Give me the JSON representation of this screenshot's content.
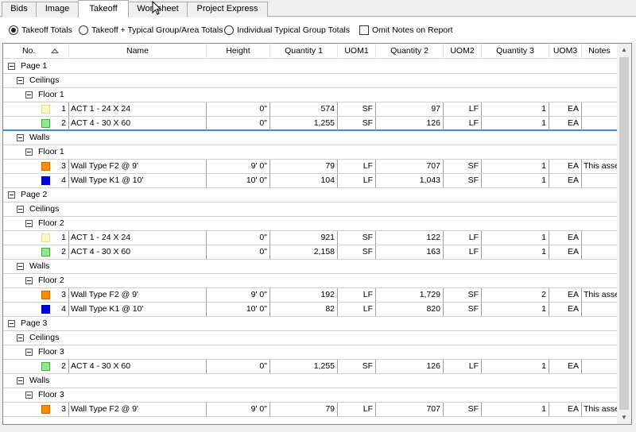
{
  "tabs": [
    {
      "label": "Bids",
      "active": false
    },
    {
      "label": "Image",
      "active": false
    },
    {
      "label": "Takeoff",
      "active": true
    },
    {
      "label": "Worksheet",
      "active": false
    },
    {
      "label": "Project Express",
      "active": false
    }
  ],
  "options": {
    "radios": [
      {
        "label": "Takeoff Totals",
        "selected": true
      },
      {
        "label": "Takeoff + Typical Group/Area Totals",
        "selected": false
      },
      {
        "label": "Individual Typical Group Totals",
        "selected": false
      }
    ],
    "omit_notes": {
      "label": "Omit Notes on Report",
      "checked": false
    }
  },
  "columns": [
    "No.",
    "Name",
    "Height",
    "Quantity 1",
    "UOM1",
    "Quantity 2",
    "UOM2",
    "Quantity 3",
    "UOM3",
    "Notes"
  ],
  "colors": {
    "cream": "#fff8c6",
    "green": "#90ee90",
    "orange": "#ff8c00",
    "blue": "#0000e0"
  },
  "rows": [
    {
      "kind": "group",
      "level": 0,
      "label": "Page 1"
    },
    {
      "kind": "group",
      "level": 1,
      "label": "Ceilings"
    },
    {
      "kind": "group",
      "level": 2,
      "label": "Floor 1"
    },
    {
      "kind": "item",
      "color": "cream",
      "no": "1",
      "name": "ACT 1 - 24 X 24",
      "height": "0\"",
      "q1": "574",
      "u1": "SF",
      "q2": "97",
      "u2": "LF",
      "q3": "1",
      "u3": "EA",
      "notes": ""
    },
    {
      "kind": "item",
      "color": "green",
      "no": "2",
      "name": "ACT 4 - 30 X 60",
      "height": "0\"",
      "q1": "1,255",
      "u1": "SF",
      "q2": "126",
      "u2": "LF",
      "q3": "1",
      "u3": "EA",
      "notes": "",
      "selected": true
    },
    {
      "kind": "group",
      "level": 1,
      "label": "Walls"
    },
    {
      "kind": "group",
      "level": 2,
      "label": "Floor 1"
    },
    {
      "kind": "item",
      "color": "orange",
      "no": "3",
      "name": "Wall Type F2 @ 9'",
      "height": "9' 0\"",
      "q1": "79",
      "u1": "LF",
      "q2": "707",
      "u2": "SF",
      "q3": "1",
      "u3": "EA",
      "notes": "This assembly f..."
    },
    {
      "kind": "item",
      "color": "blue",
      "no": "4",
      "name": "Wall Type K1 @ 10'",
      "height": "10' 0\"",
      "q1": "104",
      "u1": "LF",
      "q2": "1,043",
      "u2": "SF",
      "q3": "1",
      "u3": "EA",
      "notes": ""
    },
    {
      "kind": "group",
      "level": 0,
      "label": "Page 2"
    },
    {
      "kind": "group",
      "level": 1,
      "label": "Ceilings"
    },
    {
      "kind": "group",
      "level": 2,
      "label": "Floor 2"
    },
    {
      "kind": "item",
      "color": "cream",
      "no": "1",
      "name": "ACT 1 - 24 X 24",
      "height": "0\"",
      "q1": "921",
      "u1": "SF",
      "q2": "122",
      "u2": "LF",
      "q3": "1",
      "u3": "EA",
      "notes": ""
    },
    {
      "kind": "item",
      "color": "green",
      "no": "2",
      "name": "ACT 4 - 30 X 60",
      "height": "0\"",
      "q1": "2,158",
      "u1": "SF",
      "q2": "163",
      "u2": "LF",
      "q3": "1",
      "u3": "EA",
      "notes": ""
    },
    {
      "kind": "group",
      "level": 1,
      "label": "Walls"
    },
    {
      "kind": "group",
      "level": 2,
      "label": "Floor 2"
    },
    {
      "kind": "item",
      "color": "orange",
      "no": "3",
      "name": "Wall Type F2 @ 9'",
      "height": "9' 0\"",
      "q1": "192",
      "u1": "LF",
      "q2": "1,729",
      "u2": "SF",
      "q3": "2",
      "u3": "EA",
      "notes": "This assembly f..."
    },
    {
      "kind": "item",
      "color": "blue",
      "no": "4",
      "name": "Wall Type K1 @ 10'",
      "height": "10' 0\"",
      "q1": "82",
      "u1": "LF",
      "q2": "820",
      "u2": "SF",
      "q3": "1",
      "u3": "EA",
      "notes": ""
    },
    {
      "kind": "group",
      "level": 0,
      "label": "Page 3"
    },
    {
      "kind": "group",
      "level": 1,
      "label": "Ceilings"
    },
    {
      "kind": "group",
      "level": 2,
      "label": "Floor 3"
    },
    {
      "kind": "item",
      "color": "green",
      "no": "2",
      "name": "ACT 4 - 30 X 60",
      "height": "0\"",
      "q1": "1,255",
      "u1": "SF",
      "q2": "126",
      "u2": "LF",
      "q3": "1",
      "u3": "EA",
      "notes": ""
    },
    {
      "kind": "group",
      "level": 1,
      "label": "Walls"
    },
    {
      "kind": "group",
      "level": 2,
      "label": "Floor 3"
    },
    {
      "kind": "item",
      "color": "orange",
      "no": "3",
      "name": "Wall Type F2 @ 9'",
      "height": "9' 0\"",
      "q1": "79",
      "u1": "LF",
      "q2": "707",
      "u2": "SF",
      "q3": "1",
      "u3": "EA",
      "notes": "This assembly f..."
    }
  ]
}
